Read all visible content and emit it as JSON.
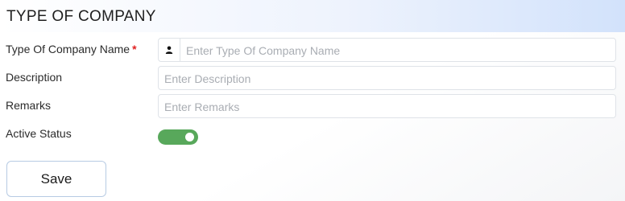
{
  "page": {
    "title": "TYPE OF COMPANY"
  },
  "form": {
    "company_name": {
      "label": "Type Of Company Name",
      "required_mark": "*",
      "placeholder": "Enter Type Of Company Name",
      "value": "",
      "icon": "user-icon"
    },
    "description": {
      "label": "Description",
      "placeholder": "Enter Description",
      "value": ""
    },
    "remarks": {
      "label": "Remarks",
      "placeholder": "Enter Remarks",
      "value": ""
    },
    "active_status": {
      "label": "Active Status",
      "on": true,
      "color": "#58a85b"
    }
  },
  "actions": {
    "save_label": "Save"
  }
}
